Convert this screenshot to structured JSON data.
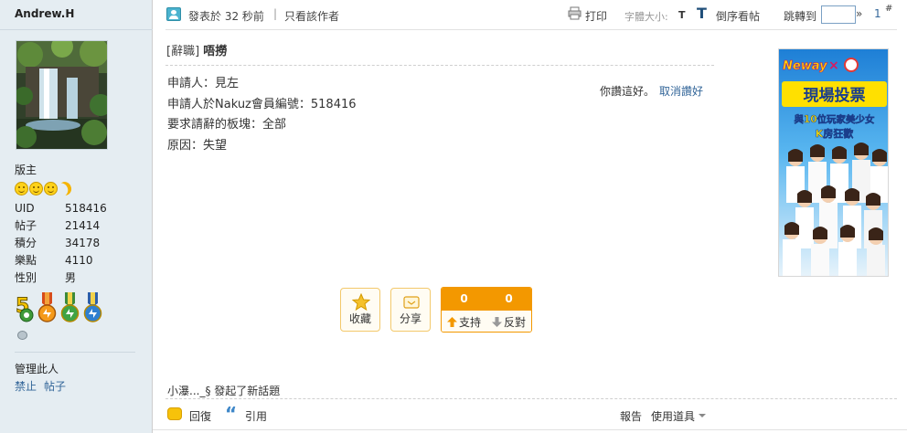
{
  "user": {
    "name": "Andrew.H",
    "rank": "版主",
    "stats": [
      {
        "label": "UID",
        "value": "518416"
      },
      {
        "label": "帖子",
        "value": "21414"
      },
      {
        "label": "積分",
        "value": "34178"
      },
      {
        "label": "樂點",
        "value": "4110"
      },
      {
        "label": "性別",
        "value": "男"
      }
    ],
    "rank_icons": [
      "smiley-icon",
      "smiley-icon",
      "smiley-icon",
      "moon-icon"
    ],
    "medals": [
      "medal-5-years-icon",
      "medal-orange-icon",
      "medal-green-icon",
      "medal-blue-icon"
    ],
    "manage_label": "管理此人",
    "manage_links": [
      "禁止",
      "帖子"
    ]
  },
  "top_bar": {
    "post_time": "發表於 32 秒前",
    "separator": "|",
    "only_author": "只看該作者",
    "print": "打印",
    "font_size_label": "字體大小:",
    "font_small": "T",
    "font_big": "T",
    "reverse": "倒序看帖",
    "jump_label": "跳轉到",
    "jump_go": "»",
    "post_number": "1",
    "post_number_suffix": "#"
  },
  "post": {
    "forum_tag": "[辭職]",
    "title": "唔撈",
    "lines": [
      "申請人：見左",
      "申請人於Nakuz會員編號：518416",
      "要求請辭的板塊：全部",
      "原因：失望"
    ],
    "like_text": "你讚這好。",
    "unlike_link": "取消讚好"
  },
  "ad": {
    "brand": "Neway",
    "headline": "現場投票",
    "subline1": "與10位玩家美少女",
    "subline2": "K房狂歡"
  },
  "actions": {
    "favorite": "收藏",
    "share": "分享",
    "support_count": "0",
    "oppose_count": "0",
    "support": "支持",
    "oppose": "反對"
  },
  "footer": {
    "new_topic": "小瀑..._§ 發起了新話題",
    "reply": "回復",
    "quote": "引用",
    "report": "報告",
    "tools": "使用道具"
  },
  "colors": {
    "sidebar_bg": "#e5edf2",
    "link": "#336699",
    "vote_orange": "#f39800",
    "button_border": "#f3c96c"
  }
}
